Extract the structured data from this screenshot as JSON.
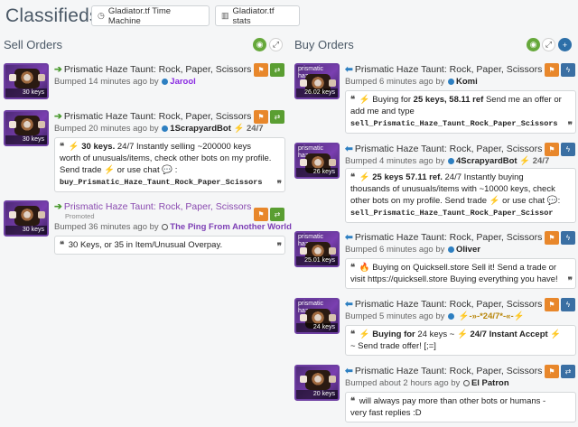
{
  "header": {
    "title": "Classifieds",
    "buttons": [
      {
        "label": "Gladiator.tf Time Machine",
        "icon": "clock-icon"
      },
      {
        "label": "Gladiator.tf stats",
        "icon": "bar-chart-icon"
      }
    ]
  },
  "sell": {
    "title": "Sell Orders",
    "listings": [
      {
        "title": "Prismatic Haze Taunt: Rock, Paper, Scissors",
        "price": "30 keys",
        "bumped": "Bumped 14 minutes ago by",
        "user": "Jarool",
        "message": null
      },
      {
        "title": "Prismatic Haze Taunt: Rock, Paper, Scissors",
        "price": "30 keys",
        "bumped": "Bumped 20 minutes ago by",
        "user": "1ScrapyardBot",
        "user_suffix": "24/7",
        "message_parts": [
          "30 keys.",
          " 24/7 Instantly selling ~200000 keys worth of unusuals/items, check other bots on my profile. Send trade ",
          " or  use  chat",
          " :"
        ],
        "message_code": "buy_Prismatic_Haze_Taunt_Rock_Paper_Scissors"
      },
      {
        "title": "Prismatic Haze Taunt: Rock, Paper, Scissors",
        "promoted": "Promoted",
        "price": "30 keys",
        "bumped": "Bumped 36 minutes ago by",
        "user": "The Ping From Another World",
        "message": "30 Keys, or 35 in Item/Unusual Overpay."
      }
    ]
  },
  "buy": {
    "title": "Buy Orders",
    "listings": [
      {
        "title": "Prismatic Haze Taunt: Rock, Paper, Scissors",
        "thumb_label": "prismatic haze",
        "price": "26.02 keys",
        "bumped": "Bumped 6 minutes ago by",
        "user": "Komi",
        "user_suffix": "[24/7]",
        "message_lead": "Buying for",
        "message_bold": "25 keys, 58.11 ref",
        "message_rest": " Send me an offer or add me and type",
        "message_code": "sell_Prismatic_Haze_Taunt_Rock_Paper_Scissors"
      },
      {
        "title": "Prismatic Haze Taunt: Rock, Paper, Scissors",
        "thumb_label": "prismatic haze",
        "price": "26 keys",
        "bumped": "Bumped 4 minutes ago by",
        "user": "4ScrapyardBot",
        "user_suffix": "24/7",
        "message_bold": "25 keys 57.11 ref.",
        "message_rest": " 24/7 Instantly buying thousands of unusuals/items with ~10000 keys, check other bots on my profile. Send  trade",
        "message_rest2": " or  use  chat",
        "message_code": "sell_Prismatic_Haze_Taunt_Rock_Paper_Scissor"
      },
      {
        "title": "Prismatic Haze Taunt: Rock, Paper, Scissors",
        "thumb_label": "prismatic haze",
        "price": "25.01 keys",
        "bumped": "Bumped 6 minutes ago by",
        "user": "Oliver",
        "message": "Buying on Quicksell.store  Sell it!  Send a trade or visit https://quicksell.store  Buying everything you have!"
      },
      {
        "title": "Prismatic Haze Taunt: Rock, Paper, Scissors",
        "thumb_label": "prismatic haze",
        "price": "24 keys",
        "bumped": "Bumped 5 minutes ago by",
        "user": "-»-*24/7*-«-",
        "message_lead": "Buying for",
        "message_mid": " 24 keys ~",
        "message_bold": "24/7 Instant Accept",
        "message_rest": " ~ Send trade offer! [;=]"
      },
      {
        "title": "Prismatic Haze Taunt: Rock, Paper, Scissors",
        "thumb_label": "",
        "price": "20 keys",
        "bumped": "Bumped about 2 hours ago by",
        "user": "El Patron",
        "message": "will always pay more than other bots or humans - very fast replies :D"
      }
    ]
  }
}
